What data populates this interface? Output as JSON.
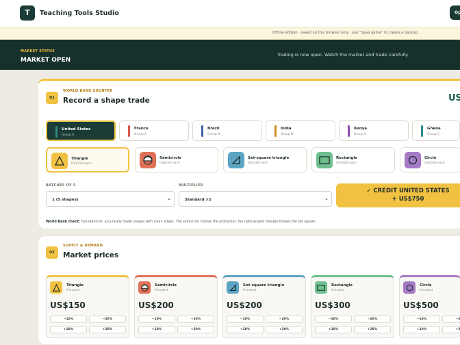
{
  "app": {
    "logo_letter": "T",
    "brand": "Teaching Tools Studio",
    "top_button": "Op"
  },
  "notice": "Offline edition · saved on this browser only · use “Save game” to create a backup.",
  "status": {
    "kicker": "MARKET STATUS",
    "state": "MARKET OPEN",
    "message": "Trading is now open. Watch the market and trade carefully."
  },
  "trade": {
    "number": "01",
    "kicker": "WORLD BANK COUNTER",
    "title": "Record a shape trade",
    "balance": "US",
    "countries": [
      {
        "name": "United States",
        "group": "Group A",
        "color": "#2f8a7c"
      },
      {
        "name": "France",
        "group": "Group A",
        "color": "#d9584a"
      },
      {
        "name": "Brazil",
        "group": "Group B",
        "color": "#3f5fa8"
      },
      {
        "name": "India",
        "group": "Group B",
        "color": "#d48a1e"
      },
      {
        "name": "Kenya",
        "group": "Group C",
        "color": "#8a4fb0"
      },
      {
        "name": "Ghana",
        "group": "Group C",
        "color": "#2f8a8a"
      }
    ],
    "shapes": [
      {
        "name": "Triangle",
        "price": "US$150 each",
        "icon": "triangle-icon"
      },
      {
        "name": "Semicircle",
        "price": "US$200 each",
        "icon": "semicircle-icon"
      },
      {
        "name": "Set-square triangle",
        "price": "US$200 each",
        "icon": "set-square-icon"
      },
      {
        "name": "Rectangle",
        "price": "US$300 each",
        "icon": "rectangle-icon"
      },
      {
        "name": "Circle",
        "price": "US$500 each",
        "icon": "circle-icon"
      }
    ],
    "batches_label": "BATCHES OF 5",
    "batches_value": "1 (5 shapes)",
    "multiplier_label": "MULTIPLIER",
    "multiplier_value": "Standard ×1",
    "credit_line1": "✓ CREDIT UNITED STATES",
    "credit_line2": "+ US$750",
    "check_label": "World Bank check:",
    "check_text": "five identical, accurately made shapes with clean edges. The semicircle follows the protractor; the right-angled triangle follows the set square."
  },
  "market": {
    "number": "02",
    "kicker": "SUPPLY & DEMAND",
    "title": "Market prices",
    "items": [
      {
        "name": "Triangle",
        "traded": "0 traded",
        "price": "US$150"
      },
      {
        "name": "Semicircle",
        "traded": "0 traded",
        "price": "US$200"
      },
      {
        "name": "Set-square triangle",
        "traded": "0 traded",
        "price": "US$200"
      },
      {
        "name": "Rectangle",
        "traded": "0 traded",
        "price": "US$300"
      },
      {
        "name": "Circle",
        "traded": "0 traded",
        "price": "US$500"
      }
    ],
    "adjust": [
      "−10%",
      "−20%",
      "+10%",
      "+20%"
    ]
  },
  "colors": {
    "accent": "#f1c241",
    "dark": "#1a3b36",
    "triangle": "#f1c241",
    "semicircle": "#e07158",
    "setsquare": "#5ba4c4",
    "rectangle": "#6fbe8d",
    "circle": "#a57ac4"
  }
}
